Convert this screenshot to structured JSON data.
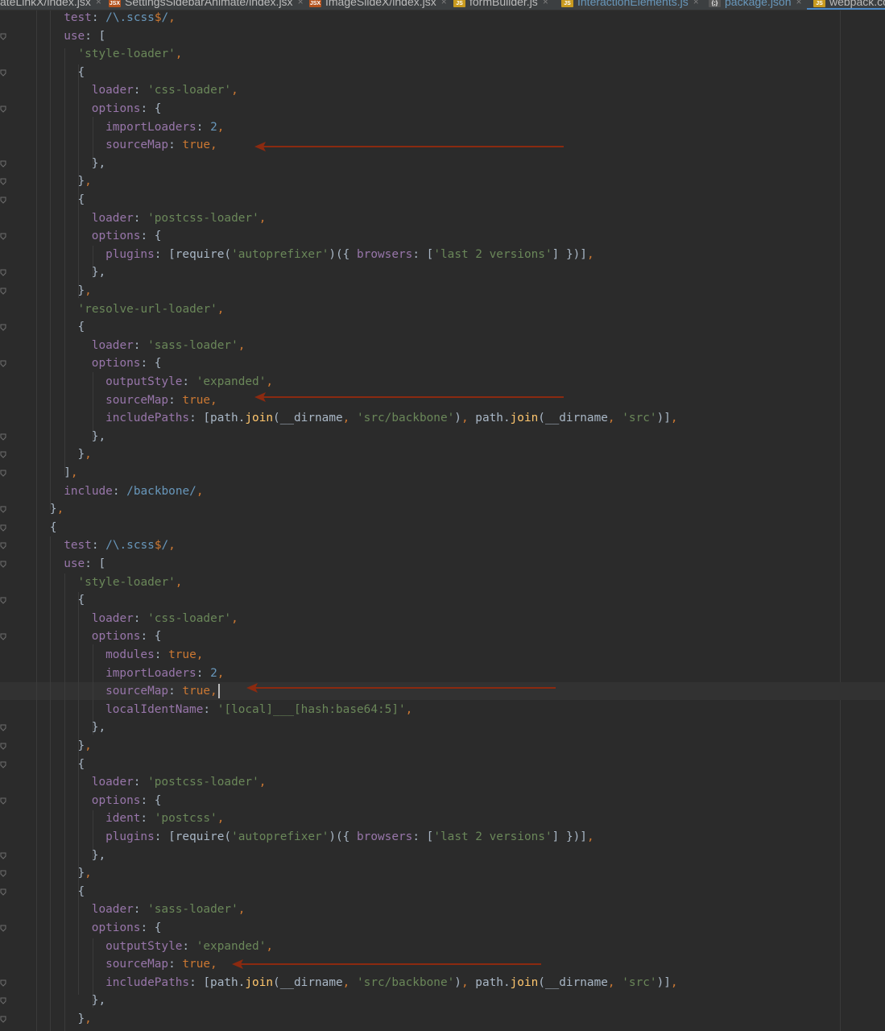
{
  "tabs": [
    {
      "label": "ateLinkX/index.jsx",
      "icon": "jsx-file-icon",
      "modified": false
    },
    {
      "label": "SettingsSidebarAnimate/index.jsx",
      "icon": "jsx-file-icon",
      "modified": false
    },
    {
      "label": "ImageSlideX/index.jsx",
      "icon": "jsx-file-icon",
      "modified": false
    },
    {
      "label": "formBuilder.js",
      "icon": "js-file-icon",
      "modified": false
    },
    {
      "label": "InteractionElements.js",
      "icon": "js-file-icon",
      "modified": true
    },
    {
      "label": "package.json",
      "icon": "json-file-icon",
      "modified": true
    },
    {
      "label": "webpack.co",
      "icon": "js-file-icon",
      "modified": false,
      "active": true
    }
  ],
  "colors": {
    "background": "#2b2b2b",
    "keyword": "#cc7832",
    "property": "#9876aa",
    "string": "#6a8759",
    "number": "#6897bb",
    "text": "#a9b7c6",
    "function": "#ffc66d",
    "arrow": "#8b2a10",
    "active_tab_underline": "#4a88c7"
  },
  "code_lines": [
    [
      [
        "k",
        "test"
      ],
      [
        "t",
        ": "
      ],
      [
        "r",
        "/\\.scss"
      ],
      [
        "p",
        "$"
      ],
      [
        "r",
        "/"
      ],
      [
        "p",
        ","
      ]
    ],
    [
      [
        "k",
        "use"
      ],
      [
        "t",
        ": ["
      ]
    ],
    [
      [
        "s",
        "'style-loader'"
      ],
      [
        "p",
        ","
      ]
    ],
    [
      [
        "t",
        "{"
      ]
    ],
    [
      [
        "k",
        "loader"
      ],
      [
        "t",
        ": "
      ],
      [
        "s",
        "'css-loader'"
      ],
      [
        "p",
        ","
      ]
    ],
    [
      [
        "k",
        "options"
      ],
      [
        "t",
        ": {"
      ]
    ],
    [
      [
        "k",
        "importLoaders"
      ],
      [
        "t",
        ": "
      ],
      [
        "n",
        "2"
      ],
      [
        "p",
        ","
      ]
    ],
    [
      [
        "k",
        "sourceMap"
      ],
      [
        "t",
        ": "
      ],
      [
        "p",
        "true,"
      ]
    ],
    [
      [
        "t",
        "},"
      ]
    ],
    [
      [
        "t",
        "}"
      ],
      [
        "p",
        ","
      ]
    ],
    [
      [
        "t",
        "{"
      ]
    ],
    [
      [
        "k",
        "loader"
      ],
      [
        "t",
        ": "
      ],
      [
        "s",
        "'postcss-loader'"
      ],
      [
        "p",
        ","
      ]
    ],
    [
      [
        "k",
        "options"
      ],
      [
        "t",
        ": {"
      ]
    ],
    [
      [
        "k",
        "plugins"
      ],
      [
        "t",
        ": [require("
      ],
      [
        "s",
        "'autoprefixer'"
      ],
      [
        "t",
        ")({ "
      ],
      [
        "k",
        "browsers"
      ],
      [
        "t",
        ": ["
      ],
      [
        "s",
        "'last 2 versions'"
      ],
      [
        "t",
        "] })]"
      ],
      [
        "p",
        ","
      ]
    ],
    [
      [
        "t",
        "},"
      ]
    ],
    [
      [
        "t",
        "}"
      ],
      [
        "p",
        ","
      ]
    ],
    [
      [
        "s",
        "'resolve-url-loader'"
      ],
      [
        "p",
        ","
      ]
    ],
    [
      [
        "t",
        "{"
      ]
    ],
    [
      [
        "k",
        "loader"
      ],
      [
        "t",
        ": "
      ],
      [
        "s",
        "'sass-loader'"
      ],
      [
        "p",
        ","
      ]
    ],
    [
      [
        "k",
        "options"
      ],
      [
        "t",
        ": {"
      ]
    ],
    [
      [
        "k",
        "outputStyle"
      ],
      [
        "t",
        ": "
      ],
      [
        "s",
        "'expanded'"
      ],
      [
        "p",
        ","
      ]
    ],
    [
      [
        "k",
        "sourceMap"
      ],
      [
        "t",
        ": "
      ],
      [
        "p",
        "true,"
      ]
    ],
    [
      [
        "k",
        "includePaths"
      ],
      [
        "t",
        ": [path."
      ],
      [
        "f",
        "join"
      ],
      [
        "t",
        "(__dirname"
      ],
      [
        "p",
        ", "
      ],
      [
        "s",
        "'src/backbone'"
      ],
      [
        "t",
        ")"
      ],
      [
        "p",
        ", "
      ],
      [
        "t",
        "path."
      ],
      [
        "f",
        "join"
      ],
      [
        "t",
        "(__dirname"
      ],
      [
        "p",
        ", "
      ],
      [
        "s",
        "'src'"
      ],
      [
        "t",
        ")]"
      ],
      [
        "p",
        ","
      ]
    ],
    [
      [
        "t",
        "},"
      ]
    ],
    [
      [
        "t",
        "}"
      ],
      [
        "p",
        ","
      ]
    ],
    [
      [
        "t",
        "]"
      ],
      [
        "p",
        ","
      ]
    ],
    [
      [
        "k",
        "include"
      ],
      [
        "t",
        ": "
      ],
      [
        "r",
        "/backbone/"
      ],
      [
        "p",
        ","
      ]
    ],
    [
      [
        "t",
        "}"
      ],
      [
        "p",
        ","
      ]
    ],
    [
      [
        "t",
        "{"
      ]
    ],
    [
      [
        "k",
        "test"
      ],
      [
        "t",
        ": "
      ],
      [
        "r",
        "/\\.scss"
      ],
      [
        "p",
        "$"
      ],
      [
        "r",
        "/"
      ],
      [
        "p",
        ","
      ]
    ],
    [
      [
        "k",
        "use"
      ],
      [
        "t",
        ": ["
      ]
    ],
    [
      [
        "s",
        "'style-loader'"
      ],
      [
        "p",
        ","
      ]
    ],
    [
      [
        "t",
        "{"
      ]
    ],
    [
      [
        "k",
        "loader"
      ],
      [
        "t",
        ": "
      ],
      [
        "s",
        "'css-loader'"
      ],
      [
        "p",
        ","
      ]
    ],
    [
      [
        "k",
        "options"
      ],
      [
        "t",
        ": {"
      ]
    ],
    [
      [
        "k",
        "modules"
      ],
      [
        "t",
        ": "
      ],
      [
        "p",
        "true,"
      ]
    ],
    [
      [
        "k",
        "importLoaders"
      ],
      [
        "t",
        ": "
      ],
      [
        "n",
        "2"
      ],
      [
        "p",
        ","
      ]
    ],
    [
      [
        "k",
        "sourceMap"
      ],
      [
        "t",
        ": "
      ],
      [
        "p",
        "true,"
      ]
    ],
    [
      [
        "k",
        "localIdentName"
      ],
      [
        "t",
        ": "
      ],
      [
        "s",
        "'[local]___[hash:base64:5]'"
      ],
      [
        "p",
        ","
      ]
    ],
    [
      [
        "t",
        "},"
      ]
    ],
    [
      [
        "t",
        "}"
      ],
      [
        "p",
        ","
      ]
    ],
    [
      [
        "t",
        "{"
      ]
    ],
    [
      [
        "k",
        "loader"
      ],
      [
        "t",
        ": "
      ],
      [
        "s",
        "'postcss-loader'"
      ],
      [
        "p",
        ","
      ]
    ],
    [
      [
        "k",
        "options"
      ],
      [
        "t",
        ": {"
      ]
    ],
    [
      [
        "k",
        "ident"
      ],
      [
        "t",
        ": "
      ],
      [
        "s",
        "'postcss'"
      ],
      [
        "p",
        ","
      ]
    ],
    [
      [
        "k",
        "plugins"
      ],
      [
        "t",
        ": [require("
      ],
      [
        "s",
        "'autoprefixer'"
      ],
      [
        "t",
        ")({ "
      ],
      [
        "k",
        "browsers"
      ],
      [
        "t",
        ": ["
      ],
      [
        "s",
        "'last 2 versions'"
      ],
      [
        "t",
        "] })]"
      ],
      [
        "p",
        ","
      ]
    ],
    [
      [
        "t",
        "},"
      ]
    ],
    [
      [
        "t",
        "}"
      ],
      [
        "p",
        ","
      ]
    ],
    [
      [
        "t",
        "{"
      ]
    ],
    [
      [
        "k",
        "loader"
      ],
      [
        "t",
        ": "
      ],
      [
        "s",
        "'sass-loader'"
      ],
      [
        "p",
        ","
      ]
    ],
    [
      [
        "k",
        "options"
      ],
      [
        "t",
        ": {"
      ]
    ],
    [
      [
        "k",
        "outputStyle"
      ],
      [
        "t",
        ": "
      ],
      [
        "s",
        "'expanded'"
      ],
      [
        "p",
        ","
      ]
    ],
    [
      [
        "k",
        "sourceMap"
      ],
      [
        "t",
        ": "
      ],
      [
        "p",
        "true,"
      ]
    ],
    [
      [
        "k",
        "includePaths"
      ],
      [
        "t",
        ": [path."
      ],
      [
        "f",
        "join"
      ],
      [
        "t",
        "(__dirname"
      ],
      [
        "p",
        ", "
      ],
      [
        "s",
        "'src/backbone'"
      ],
      [
        "t",
        ")"
      ],
      [
        "p",
        ", "
      ],
      [
        "t",
        "path."
      ],
      [
        "f",
        "join"
      ],
      [
        "t",
        "(__dirname"
      ],
      [
        "p",
        ", "
      ],
      [
        "s",
        "'src'"
      ],
      [
        "t",
        ")]"
      ],
      [
        "p",
        ","
      ]
    ],
    [
      [
        "t",
        "},"
      ]
    ],
    [
      [
        "t",
        "}"
      ],
      [
        "p",
        ","
      ]
    ]
  ]
}
